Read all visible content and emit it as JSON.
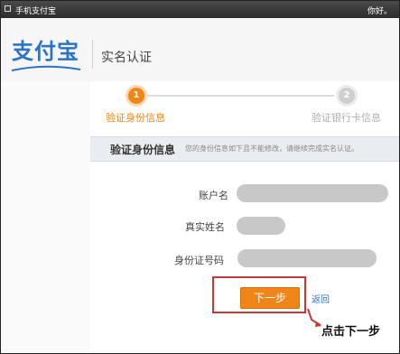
{
  "window": {
    "title": "手机支付宝",
    "greeting": "你好。"
  },
  "header": {
    "logo_text": "支付宝",
    "page_title": "实名认证"
  },
  "steps": [
    {
      "number": "1",
      "label": "验证身份信息",
      "active": true
    },
    {
      "number": "2",
      "label": "验证银行卡信息",
      "active": false
    }
  ],
  "section": {
    "title": "验证身份信息",
    "note": "您的身份信息如下且不能修改，请继续完成实名认证。"
  },
  "fields": [
    {
      "label": "账户名",
      "value_hidden": true
    },
    {
      "label": "真实姓名",
      "value_hidden": true
    },
    {
      "label": "身份证号码",
      "value_hidden": true
    }
  ],
  "actions": {
    "next_label": "下一步",
    "back_label": "返回"
  },
  "annotation": {
    "text": "点击下一步"
  },
  "colors": {
    "accent": "#f08518",
    "brand": "#2c74c3",
    "highlight": "#c43a3a"
  }
}
